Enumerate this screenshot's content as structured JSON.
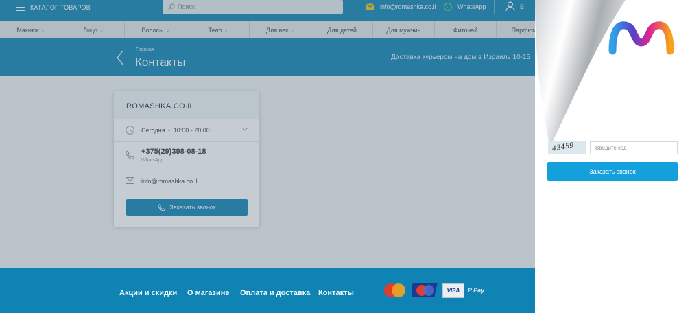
{
  "header": {
    "catalog_label": "КАТАЛОГ ТОВАРОВ",
    "search_placeholder": "Поиск",
    "email": "info@romashka.co.il",
    "whatsapp": "WhatsApp",
    "user_label": "В"
  },
  "menu": {
    "items": [
      {
        "label": "Макияж",
        "has_chevron": true
      },
      {
        "label": "Лицо",
        "has_chevron": true
      },
      {
        "label": "Волосы",
        "has_chevron": true
      },
      {
        "label": "Тело",
        "has_chevron": true
      },
      {
        "label": "Для век",
        "has_chevron": true
      },
      {
        "label": "Для детей",
        "has_chevron": false
      },
      {
        "label": "Для мужчин",
        "has_chevron": false
      },
      {
        "label": "Фиточай",
        "has_chevron": false
      },
      {
        "label": "Парфюм",
        "has_chevron": false
      }
    ]
  },
  "band": {
    "breadcrumb": "Главная",
    "title": "Контакты",
    "delivery": "Доставка курьером на дом в Израиль 10-15"
  },
  "card": {
    "name": "ROMASHKA.CO.IL",
    "hours_day": "Сегодня",
    "hours_time": "10:00 - 20:00",
    "phone": "+375(29)398-08-18",
    "phone_sub": "WhatsApp",
    "email": "info@romashka.co.il",
    "callback_label": "Заказать звонок"
  },
  "footer": {
    "links": [
      "Акции и скидки",
      "О магазине",
      "Оплата и доставка",
      "Контакты"
    ],
    "payment_icons": [
      "mastercard-icon",
      "maestro-icon",
      "visa-icon",
      "paypal-icon"
    ],
    "paypal_label": "P Pay",
    "visa_label": "VISA"
  },
  "panel": {
    "captcha_text": "43459",
    "captcha_placeholder": "Введите код",
    "order_label": "Заказать звонок"
  },
  "colors": {
    "brand_blue": "#0e83b4",
    "button_blue": "#14a0dc",
    "status_green": "#2fb55b"
  }
}
